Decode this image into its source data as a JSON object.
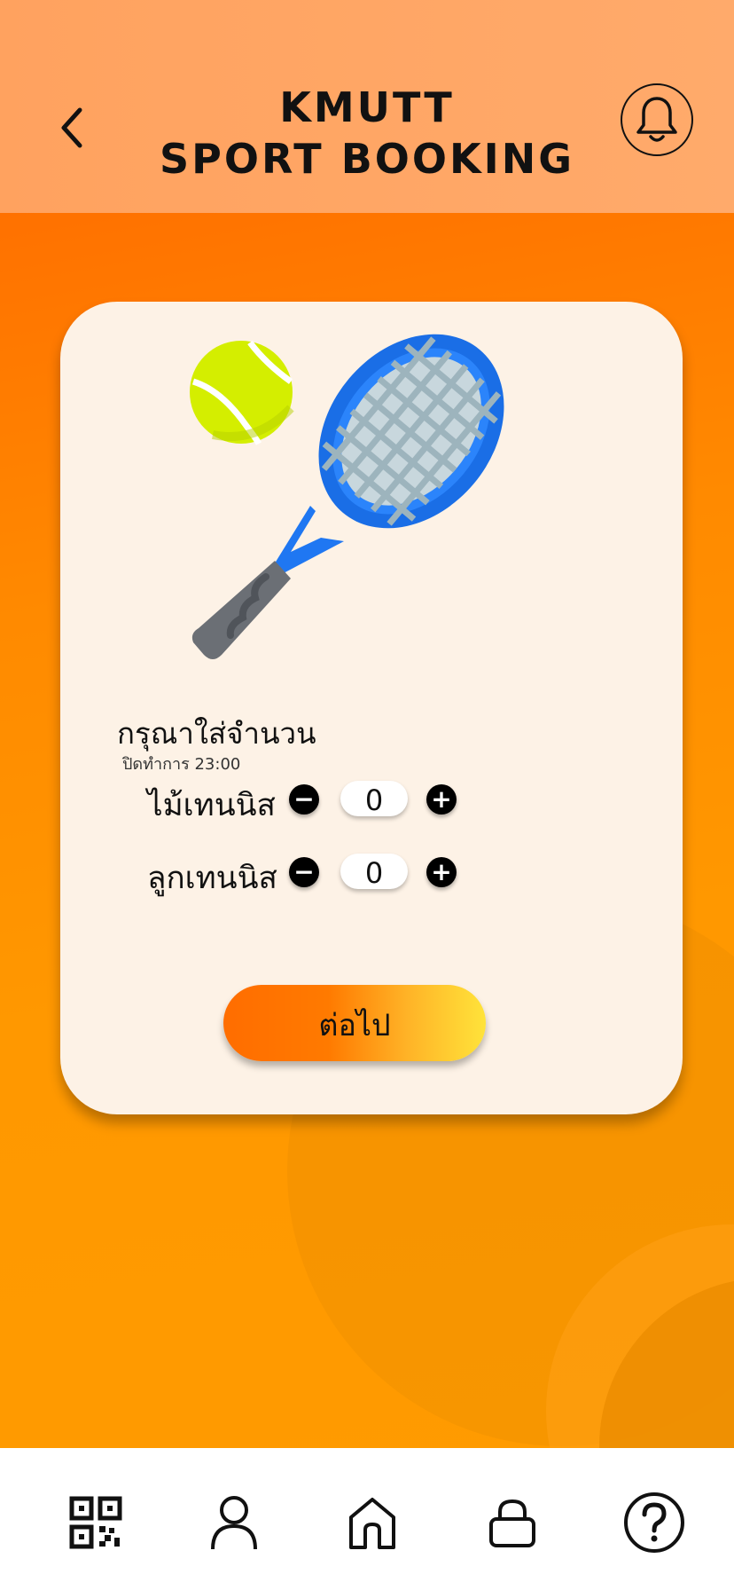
{
  "header": {
    "title_line1": "KMUTT",
    "title_line2": "SPORT BOOKING",
    "back_icon": "chevron-left-icon",
    "notification_icon": "bell-icon"
  },
  "card": {
    "illustration": "tennis-racket-and-ball-icon",
    "prompt": "กรุณาใส่จำนวน",
    "hours": "ปิดทำการ 23:00",
    "items": [
      {
        "label": "ไม้เทนนิส",
        "value": "0",
        "minus": "−",
        "plus": "+"
      },
      {
        "label": "ลูกเทนนิส",
        "value": "0",
        "minus": "−",
        "plus": "+"
      }
    ],
    "next_label": "ต่อไป"
  },
  "bottom_nav": {
    "items": [
      "qr-code-icon",
      "user-icon",
      "home-icon",
      "lock-icon",
      "help-icon"
    ]
  },
  "colors": {
    "header_bg": "#ffa664",
    "main_bg": "#ff9100",
    "card_bg": "#fdf2e6",
    "racket": "#1f77f2",
    "ball": "#d4ee00"
  }
}
